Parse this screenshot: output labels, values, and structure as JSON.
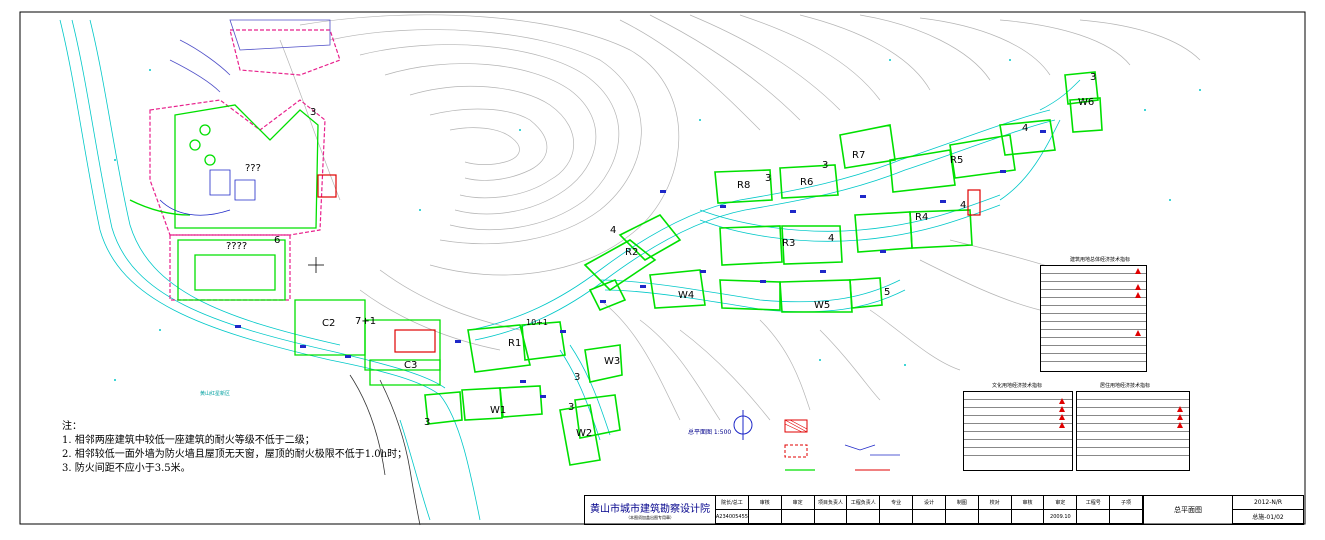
{
  "labels": {
    "buildings": {
      "r1": "R1",
      "r2": "R2",
      "r3": "R3",
      "r4": "R4",
      "r5": "R5",
      "r6": "R6",
      "r7": "R7",
      "r8": "R8",
      "w1": "W1",
      "w2": "W2",
      "w3": "W3",
      "w4": "W4",
      "w5": "W5",
      "w6": "W6",
      "c2": "C2",
      "c3": "C3",
      "c7": "7+1",
      "c10": "10+1"
    },
    "floors": [
      "3",
      "3",
      "4",
      "4",
      "4",
      "5",
      "3",
      "3",
      "4",
      "6",
      "3",
      "3",
      "3"
    ],
    "unknown_1": "???",
    "unknown_2": "????",
    "hill_label": "黄山红星新区"
  },
  "notes": {
    "heading": "注：",
    "items": [
      "1. 相邻两座建筑中较低一座建筑的耐火等级不低于二级；",
      "2. 相邻较低一面外墙为防火墙且屋顶无天窗，屋顶的耐火极限不低于1.0h时；",
      "3. 防火间距不应小于3.5米。"
    ]
  },
  "scale": "总平面图 1:500",
  "tables": {
    "t1_title": "建筑用地总体经济技术指标",
    "t2_title": "文化用地经济技术指标",
    "t3_title": "居住用地经济技术指标"
  },
  "titleblock": {
    "institute": "黄山市城市建筑勘察设计院",
    "institute_sub": "（本图须加盖出图专用章）",
    "cert_no": "A234005455",
    "headers": [
      "院长/总工",
      "审核",
      "审定",
      "项目负责人",
      "工程负责人",
      "专业",
      "设计",
      "制图",
      "校对",
      "审核",
      "审定",
      "工程号",
      "子项"
    ],
    "date": "2009.10",
    "drawing_name": "总平面图",
    "project_no": "2012-N/R",
    "sheet_no": "总施-01/02"
  },
  "colors": {
    "building": "#00e000",
    "road": "#00c8c8",
    "contour": "#b0b0b0",
    "boundary": "#e8208c",
    "redline": "#e00000",
    "blue": "#1e28c8"
  }
}
